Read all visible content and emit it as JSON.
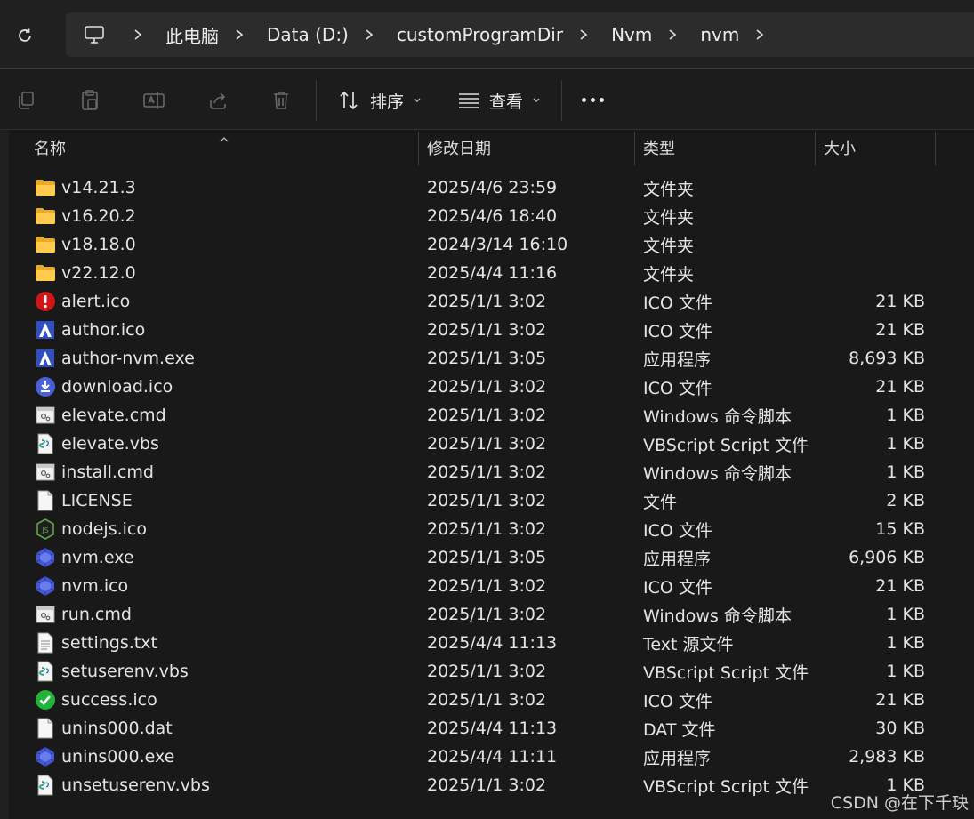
{
  "breadcrumb": [
    "此电脑",
    "Data (D:)",
    "customProgramDir",
    "Nvm",
    "nvm"
  ],
  "toolbar": {
    "sort_label": "排序",
    "view_label": "查看"
  },
  "columns": {
    "name": "名称",
    "date": "修改日期",
    "type": "类型",
    "size": "大小"
  },
  "files": [
    {
      "name": "v14.21.3",
      "date": "2025/4/6 23:59",
      "type": "文件夹",
      "size": "",
      "icon": "folder"
    },
    {
      "name": "v16.20.2",
      "date": "2025/4/6 18:40",
      "type": "文件夹",
      "size": "",
      "icon": "folder"
    },
    {
      "name": "v18.18.0",
      "date": "2024/3/14 16:10",
      "type": "文件夹",
      "size": "",
      "icon": "folder"
    },
    {
      "name": "v22.12.0",
      "date": "2025/4/4 11:16",
      "type": "文件夹",
      "size": "",
      "icon": "folder"
    },
    {
      "name": "alert.ico",
      "date": "2025/1/1 3:02",
      "type": "ICO 文件",
      "size": "21 KB",
      "icon": "alert"
    },
    {
      "name": "author.ico",
      "date": "2025/1/1 3:02",
      "type": "ICO 文件",
      "size": "21 KB",
      "icon": "author"
    },
    {
      "name": "author-nvm.exe",
      "date": "2025/1/1 3:05",
      "type": "应用程序",
      "size": "8,693 KB",
      "icon": "author"
    },
    {
      "name": "download.ico",
      "date": "2025/1/1 3:02",
      "type": "ICO 文件",
      "size": "21 KB",
      "icon": "download"
    },
    {
      "name": "elevate.cmd",
      "date": "2025/1/1 3:02",
      "type": "Windows 命令脚本",
      "size": "1 KB",
      "icon": "cmd"
    },
    {
      "name": "elevate.vbs",
      "date": "2025/1/1 3:02",
      "type": "VBScript Script 文件",
      "size": "1 KB",
      "icon": "vbs"
    },
    {
      "name": "install.cmd",
      "date": "2025/1/1 3:02",
      "type": "Windows 命令脚本",
      "size": "1 KB",
      "icon": "cmd"
    },
    {
      "name": "LICENSE",
      "date": "2025/1/1 3:02",
      "type": "文件",
      "size": "2 KB",
      "icon": "file"
    },
    {
      "name": "nodejs.ico",
      "date": "2025/1/1 3:02",
      "type": "ICO 文件",
      "size": "15 KB",
      "icon": "nodejs"
    },
    {
      "name": "nvm.exe",
      "date": "2025/1/1 3:05",
      "type": "应用程序",
      "size": "6,906 KB",
      "icon": "nvm"
    },
    {
      "name": "nvm.ico",
      "date": "2025/1/1 3:02",
      "type": "ICO 文件",
      "size": "21 KB",
      "icon": "nvm"
    },
    {
      "name": "run.cmd",
      "date": "2025/1/1 3:02",
      "type": "Windows 命令脚本",
      "size": "1 KB",
      "icon": "cmd"
    },
    {
      "name": "settings.txt",
      "date": "2025/4/4 11:13",
      "type": "Text 源文件",
      "size": "1 KB",
      "icon": "txt"
    },
    {
      "name": "setuserenv.vbs",
      "date": "2025/1/1 3:02",
      "type": "VBScript Script 文件",
      "size": "1 KB",
      "icon": "vbs"
    },
    {
      "name": "success.ico",
      "date": "2025/1/1 3:02",
      "type": "ICO 文件",
      "size": "21 KB",
      "icon": "success"
    },
    {
      "name": "unins000.dat",
      "date": "2025/4/4 11:13",
      "type": "DAT 文件",
      "size": "30 KB",
      "icon": "file"
    },
    {
      "name": "unins000.exe",
      "date": "2025/4/4 11:11",
      "type": "应用程序",
      "size": "2,983 KB",
      "icon": "nvm"
    },
    {
      "name": "unsetuserenv.vbs",
      "date": "2025/1/1 3:02",
      "type": "VBScript Script 文件",
      "size": "1 KB",
      "icon": "vbs"
    }
  ],
  "watermark": "CSDN @在下千玦"
}
